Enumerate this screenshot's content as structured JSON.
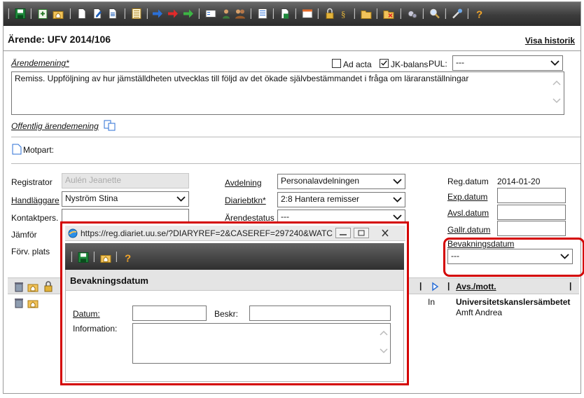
{
  "header": {
    "title": "Ärende: UFV 2014/106",
    "history_link": "Visa historik"
  },
  "form": {
    "arendemening_label": "Ärendemening*",
    "ad_acta_label": "Ad acta",
    "ad_acta_checked": false,
    "jk_balans_label": "JK-balans",
    "jk_balans_checked": true,
    "pul_label": "PUL:",
    "pul_value": "---",
    "arendemening_text": "Remiss. Uppföljning av hur jämställdheten utvecklas till följd av det ökade självbestämmandet i fråga om läraranställningar",
    "offentlig_label": "Offentlig ärendemening",
    "motpart_label": "Motpart:",
    "registrator_label": "Registrator",
    "registrator_value": "Aulén Jeanette",
    "handlaggare_label": "Handläggare",
    "handlaggare_value": "Nyström Stina",
    "kontaktpers_label": "Kontaktpers.",
    "jamfor_label": "Jämför",
    "forv_plats_label": "Förv. plats",
    "avdelning_label": "Avdelning",
    "avdelning_value": "Personalavdelningen",
    "diariebtkn_label": "Diariebtkn*",
    "diariebtkn_value": "2:8 Hantera remisser",
    "arendestatus_label": "Ärendestatus",
    "arendestatus_value": "---",
    "regdatum_label": "Reg.datum",
    "regdatum_value": "2014-01-20",
    "expdatum_label": "Exp.datum",
    "avsldatum_label": "Avsl.datum",
    "gallrdatum_label": "Gallr.datum",
    "bevakningsdatum_label": "Bevakningsdatum",
    "bevakningsdatum_value": "---"
  },
  "grid": {
    "col_avs_label": "Avs./mott.",
    "row": {
      "direction": "In",
      "org": "Universitetskanslersämbetet",
      "person": "Amft Andrea"
    }
  },
  "popup": {
    "url": "https://reg.diariet.uu.se/?DIARYREF=2&CASEREF=297240&WATCHD...",
    "heading": "Bevakningsdatum",
    "datum_label": "Datum:",
    "beskr_label": "Beskr:",
    "information_label": "Information:"
  },
  "colors": {
    "highlight": "#d40000",
    "toolbar": "#3c3c3c"
  }
}
